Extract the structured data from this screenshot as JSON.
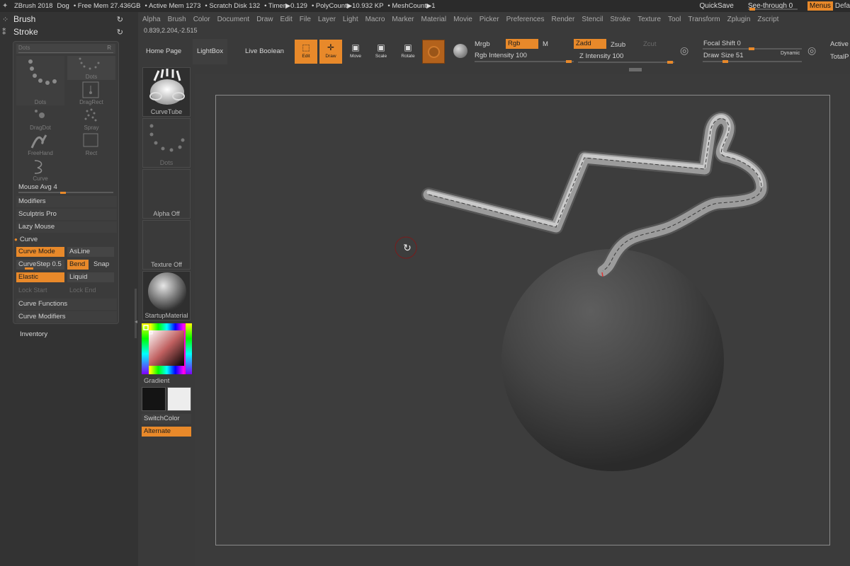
{
  "titlebar": {
    "app": "ZBrush 2018",
    "doc": "Dog",
    "free_mem": "• Free Mem 27.436GB",
    "active_mem": "• Active Mem 1273",
    "scratch": "• Scratch Disk 132",
    "timer": "• Timer▶0.129",
    "polycount": "• PolyCount▶10.932 KP",
    "meshcount": "• MeshCount▶1",
    "quicksave": "QuickSave",
    "seethrough": "See-through  0",
    "menus": "Menus",
    "default": "Defa"
  },
  "menubar": [
    "Alpha",
    "Brush",
    "Color",
    "Document",
    "Draw",
    "Edit",
    "File",
    "Layer",
    "Light",
    "Macro",
    "Marker",
    "Material",
    "Movie",
    "Picker",
    "Preferences",
    "Render",
    "Stencil",
    "Stroke",
    "Texture",
    "Tool",
    "Transform",
    "Zplugin",
    "Zscript"
  ],
  "coords": "0.839,2.204,-2.515",
  "left": {
    "brush_title": "Brush",
    "stroke_title": "Stroke",
    "dots_slider": "Dots",
    "dots_slider_r": "R",
    "strokes": [
      "Dots",
      "Dots",
      "DragRect",
      "DragDot",
      "Spray",
      "FreeHand",
      "Rect",
      "Curve"
    ],
    "mouse_avg": "Mouse Avg 4",
    "modifiers": "Modifiers",
    "sculptris": "Sculptris Pro",
    "lazy": "Lazy Mouse",
    "curve": "Curve",
    "curve_mode": "Curve Mode",
    "asline": "AsLine",
    "curvestep": "CurveStep 0.5",
    "bend": "Bend",
    "snap": "Snap",
    "elastic": "Elastic",
    "liquid": "Liquid",
    "lock_start": "Lock Start",
    "lock_end": "Lock End",
    "curve_functions": "Curve Functions",
    "curve_modifiers": "Curve Modifiers",
    "inventory": "Inventory"
  },
  "shelf": {
    "home": "Home Page",
    "lightbox": "LightBox",
    "live_boolean": "Live Boolean",
    "edit": "Edit",
    "draw": "Draw",
    "move": "Move",
    "scale": "Scale",
    "rotate": "Rotate",
    "mrgb": "Mrgb",
    "rgb": "Rgb",
    "m": "M",
    "rgb_intensity": "Rgb Intensity 100",
    "zadd": "Zadd",
    "zsub": "Zsub",
    "zcut": "Zcut",
    "z_intensity": "Z Intensity 100",
    "focal_shift": "Focal Shift 0",
    "draw_size": "Draw Size 51",
    "dynamic": "Dynamic",
    "active": "Active",
    "totalp": "TotalP"
  },
  "vshelf": {
    "brush": "CurveTube",
    "stroke": "Dots",
    "alpha": "Alpha Off",
    "texture": "Texture Off",
    "material": "StartupMaterial",
    "gradient": "Gradient",
    "switchcolor": "SwitchColor",
    "alternate": "Alternate"
  },
  "colors": {
    "accent": "#e8892a",
    "bg": "#3a3a3a",
    "panel": "#333333"
  }
}
